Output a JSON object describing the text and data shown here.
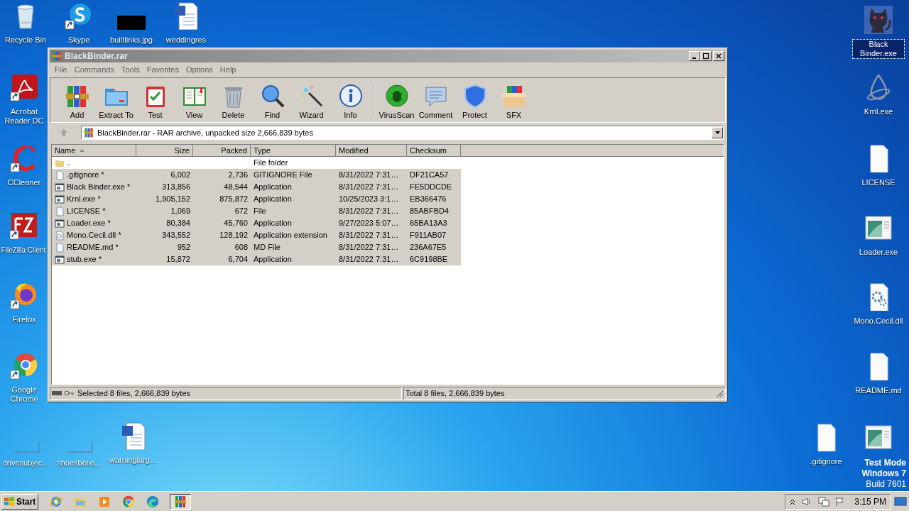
{
  "desktop_icons": [
    {
      "label": "Recycle Bin",
      "kind": "recycle",
      "shortcut": false,
      "selected": false
    },
    {
      "label": "Skype",
      "kind": "chat",
      "shortcut": true,
      "selected": false
    },
    {
      "label": "builtlinks.jpg",
      "kind": "image",
      "shortcut": false,
      "selected": false
    },
    {
      "label": "weddingres",
      "kind": "word",
      "shortcut": false,
      "selected": false
    },
    {
      "label": "Black Binder.exe",
      "kind": "cat",
      "shortcut": false,
      "selected": true
    },
    {
      "label": "Acrobat Reader DC",
      "kind": "pdf",
      "shortcut": true,
      "selected": false
    },
    {
      "label": "Krnl.exe",
      "kind": "drop",
      "shortcut": false,
      "selected": false
    },
    {
      "label": "CCleaner",
      "kind": "cleaner",
      "shortcut": true,
      "selected": false
    },
    {
      "label": "LICENSE",
      "kind": "file",
      "shortcut": false,
      "selected": false
    },
    {
      "label": "FileZilla Client",
      "kind": "ftp",
      "shortcut": true,
      "selected": false
    },
    {
      "label": "Loader.exe",
      "kind": "window",
      "shortcut": false,
      "selected": false
    },
    {
      "label": "Firefox",
      "kind": "firefox",
      "shortcut": true,
      "selected": false
    },
    {
      "label": "Mono.Cecil.dll",
      "kind": "dll",
      "shortcut": false,
      "selected": false
    },
    {
      "label": "Google Chrome",
      "kind": "chrome",
      "shortcut": true,
      "selected": false
    },
    {
      "label": "README.md",
      "kind": "file",
      "shortcut": false,
      "selected": false
    },
    {
      "label": "drivesubjec…",
      "kind": "thumb",
      "shortcut": false,
      "selected": false
    },
    {
      "label": "shoesbelie…",
      "kind": "thumb",
      "shortcut": false,
      "selected": false
    },
    {
      "label": "warninglarg…",
      "kind": "word",
      "shortcut": false,
      "selected": false
    },
    {
      "label": ".gitignore",
      "kind": "file",
      "shortcut": false,
      "selected": false
    },
    {
      "kind": "window",
      "shortcut": false,
      "selected": false
    }
  ],
  "window": {
    "title": "BlackBinder.rar",
    "menu": [
      "File",
      "Commands",
      "Tools",
      "Favorites",
      "Options",
      "Help"
    ],
    "toolbar": {
      "groups": [
        [
          {
            "label": "Add",
            "kind": "add"
          },
          {
            "label": "Extract To",
            "kind": "extract"
          },
          {
            "label": "Test",
            "kind": "test"
          },
          {
            "label": "View",
            "kind": "view"
          },
          {
            "label": "Delete",
            "kind": "delete"
          },
          {
            "label": "Find",
            "kind": "find"
          },
          {
            "label": "Wizard",
            "kind": "wizard"
          },
          {
            "label": "Info",
            "kind": "info"
          }
        ],
        [
          {
            "label": "VirusScan",
            "kind": "virusscan"
          },
          {
            "label": "Comment",
            "kind": "comment"
          },
          {
            "label": "Protect",
            "kind": "protect"
          },
          {
            "label": "SFX",
            "kind": "sfx"
          }
        ]
      ]
    },
    "address": "BlackBinder.rar - RAR archive, unpacked size 2,666,839 bytes",
    "columns": [
      {
        "label": "Name",
        "sorted": true
      },
      {
        "label": "Size",
        "sorted": false
      },
      {
        "label": "Packed",
        "sorted": false
      },
      {
        "label": "Type",
        "sorted": false
      },
      {
        "label": "Modified",
        "sorted": false
      },
      {
        "label": "Checksum",
        "sorted": false
      }
    ],
    "rows": [
      {
        "kind": "folder",
        "name": "..",
        "size": "",
        "packed": "",
        "type": "File folder",
        "modified": "",
        "checksum": "",
        "selected": false
      },
      {
        "kind": "file",
        "name": ".gitignore *",
        "size": "6,002",
        "packed": "2,736",
        "type": "GITIGNORE File",
        "modified": "8/31/2022 7:31…",
        "checksum": "DF21CA57",
        "selected": true
      },
      {
        "kind": "app",
        "name": "Black Binder.exe *",
        "size": "313,856",
        "packed": "48,544",
        "type": "Application",
        "modified": "8/31/2022 7:31…",
        "checksum": "FE5DDCDE",
        "selected": true
      },
      {
        "kind": "app",
        "name": "Krnl.exe *",
        "size": "1,905,152",
        "packed": "875,872",
        "type": "Application",
        "modified": "10/25/2023 3:1…",
        "checksum": "EB366476",
        "selected": true
      },
      {
        "kind": "file",
        "name": "LICENSE *",
        "size": "1,069",
        "packed": "672",
        "type": "File",
        "modified": "8/31/2022 7:31…",
        "checksum": "85ABFBD4",
        "selected": true
      },
      {
        "kind": "app",
        "name": "Loader.exe *",
        "size": "80,384",
        "packed": "45,760",
        "type": "Application",
        "modified": "9/27/2023 5:07…",
        "checksum": "65BA13A3",
        "selected": true
      },
      {
        "kind": "dll",
        "name": "Mono.Cecil.dll *",
        "size": "343,552",
        "packed": "128,192",
        "type": "Application extension",
        "modified": "8/31/2022 7:31…",
        "checksum": "F911AB07",
        "selected": true
      },
      {
        "kind": "file",
        "name": "README.md *",
        "size": "952",
        "packed": "608",
        "type": "MD File",
        "modified": "8/31/2022 7:31…",
        "checksum": "236A67E5",
        "selected": true
      },
      {
        "kind": "app",
        "name": "stub.exe *",
        "size": "15,872",
        "packed": "6,704",
        "type": "Application",
        "modified": "8/31/2022 7:31…",
        "checksum": "6C9198BE",
        "selected": true
      }
    ],
    "status_left": "Selected 8 files, 2,666,839 bytes",
    "status_right": "Total 8 files, 2,666,839 bytes"
  },
  "watermark_text": [
    "Test Mode",
    "Windows 7",
    "Build 7601"
  ],
  "taskbar": {
    "start": "Start",
    "apps": [
      {
        "kind": "ie",
        "active": false
      },
      {
        "kind": "explorer",
        "active": false
      },
      {
        "kind": "media",
        "active": false
      },
      {
        "kind": "chrome",
        "active": false
      },
      {
        "kind": "edge",
        "active": false
      },
      {
        "kind": "winrar",
        "active": true
      }
    ],
    "time": "3:15 PM"
  }
}
